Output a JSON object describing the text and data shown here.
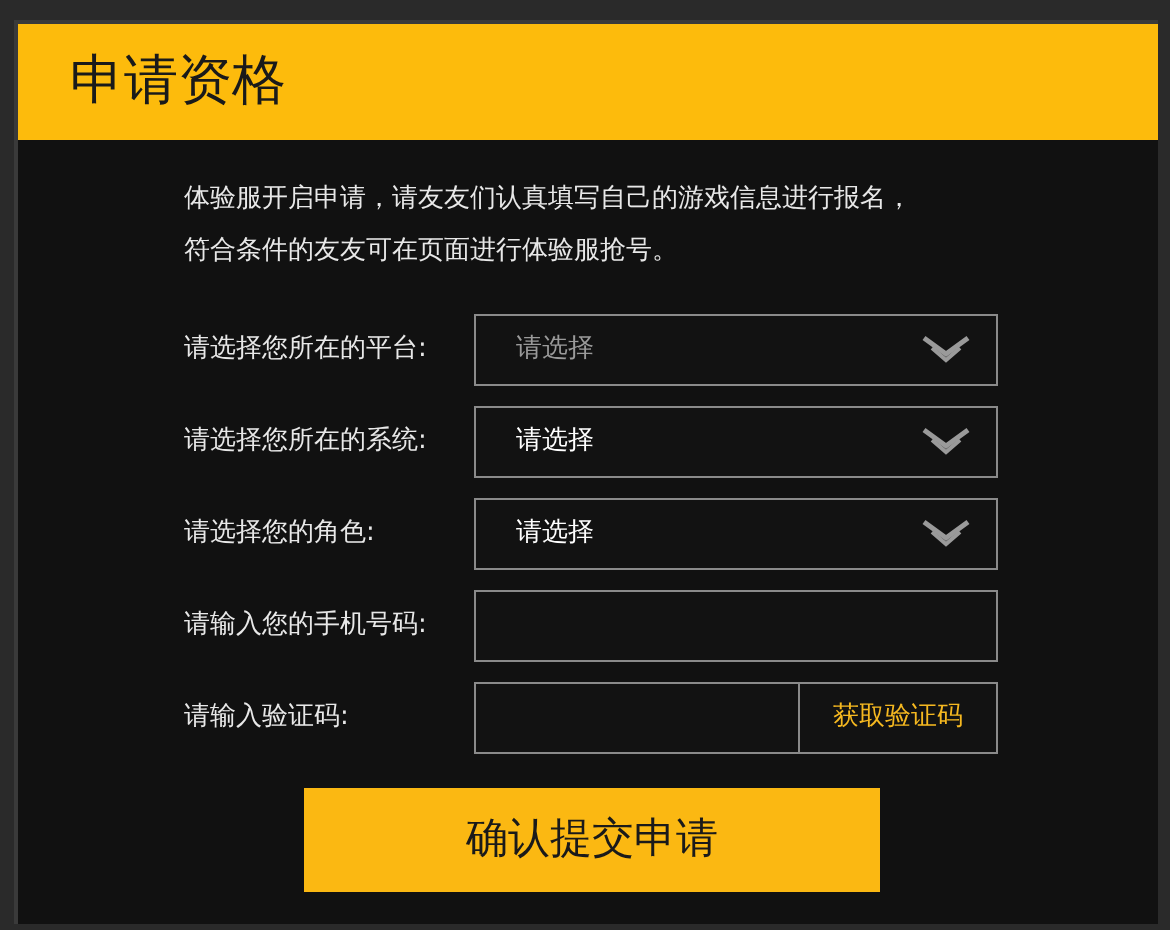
{
  "title": "申请资格",
  "intro": [
    "体验服开启申请，请友友们认真填写自己的游戏信息进行报名，",
    "符合条件的友友可在页面进行体验服抢号。"
  ],
  "fields": [
    {
      "kind": "select",
      "label": "请选择您所在的平台:",
      "placeholder": "请选择"
    },
    {
      "kind": "select",
      "label": "请选择您所在的系统:",
      "value": "请选择"
    },
    {
      "kind": "select",
      "label": "请选择您的角色:",
      "value": "请选择"
    },
    {
      "kind": "text",
      "label": "请输入您的手机号码:"
    },
    {
      "kind": "code",
      "label": "请输入验证码:",
      "button": "获取验证码"
    }
  ],
  "submit": "确认提交申请"
}
